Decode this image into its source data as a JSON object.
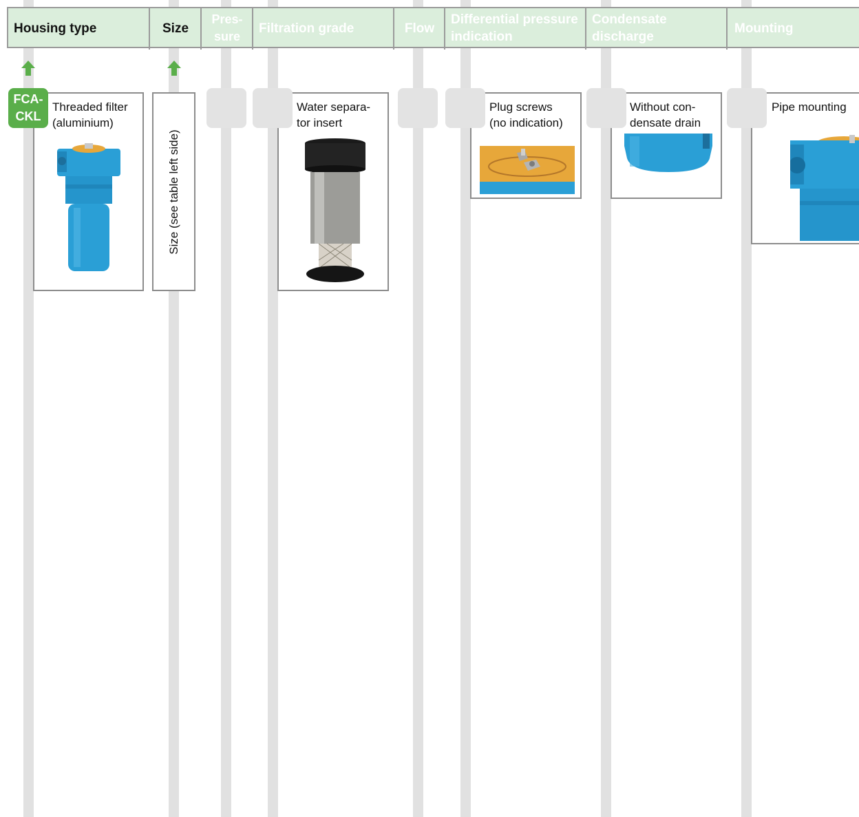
{
  "header": {
    "columns": [
      {
        "key": "housing_type",
        "label": "Housing type",
        "active": true
      },
      {
        "key": "size",
        "label": "Size",
        "active": true
      },
      {
        "key": "pressure",
        "label": "Pres-\nsure",
        "active": false
      },
      {
        "key": "filtration_grade",
        "label": "Filtration grade",
        "active": false
      },
      {
        "key": "flow",
        "label": "Flow",
        "active": false
      },
      {
        "key": "diff_pressure",
        "label": "Differential pressure indication",
        "active": false
      },
      {
        "key": "condensate",
        "label": "Condensate discharge",
        "active": false
      },
      {
        "key": "mounting",
        "label": "Mounting",
        "active": false
      }
    ]
  },
  "housing": {
    "code_line1": "FCA-",
    "code_line2": "CKL",
    "label_line1": "Threaded filter",
    "label_line2": "(aluminium)",
    "image_icon": "blue-filter-housing-image"
  },
  "size": {
    "label": "Size (see table left side)"
  },
  "filtration": {
    "label_line1": "Water separa-",
    "label_line2": "tor insert",
    "image_icon": "filter-insert-image"
  },
  "diff_pressure": {
    "label_line1": "Plug screws",
    "label_line2": "(no indication)",
    "image_icon": "plug-screws-image"
  },
  "condensate": {
    "label_line1": "Without con-",
    "label_line2": "densate drain",
    "image_icon": "bowl-without-drain-image"
  },
  "mounting": {
    "label": "Pipe mounting",
    "image_icon": "pipe-mounting-image"
  },
  "colors": {
    "header_bg": "#dbeedc",
    "accent_green": "#5aae4a",
    "line_grey": "#e1e1e1",
    "slot_grey": "#e3e3e3",
    "housing_blue": "#2a9fd6",
    "cap_orange": "#e7a73a"
  }
}
